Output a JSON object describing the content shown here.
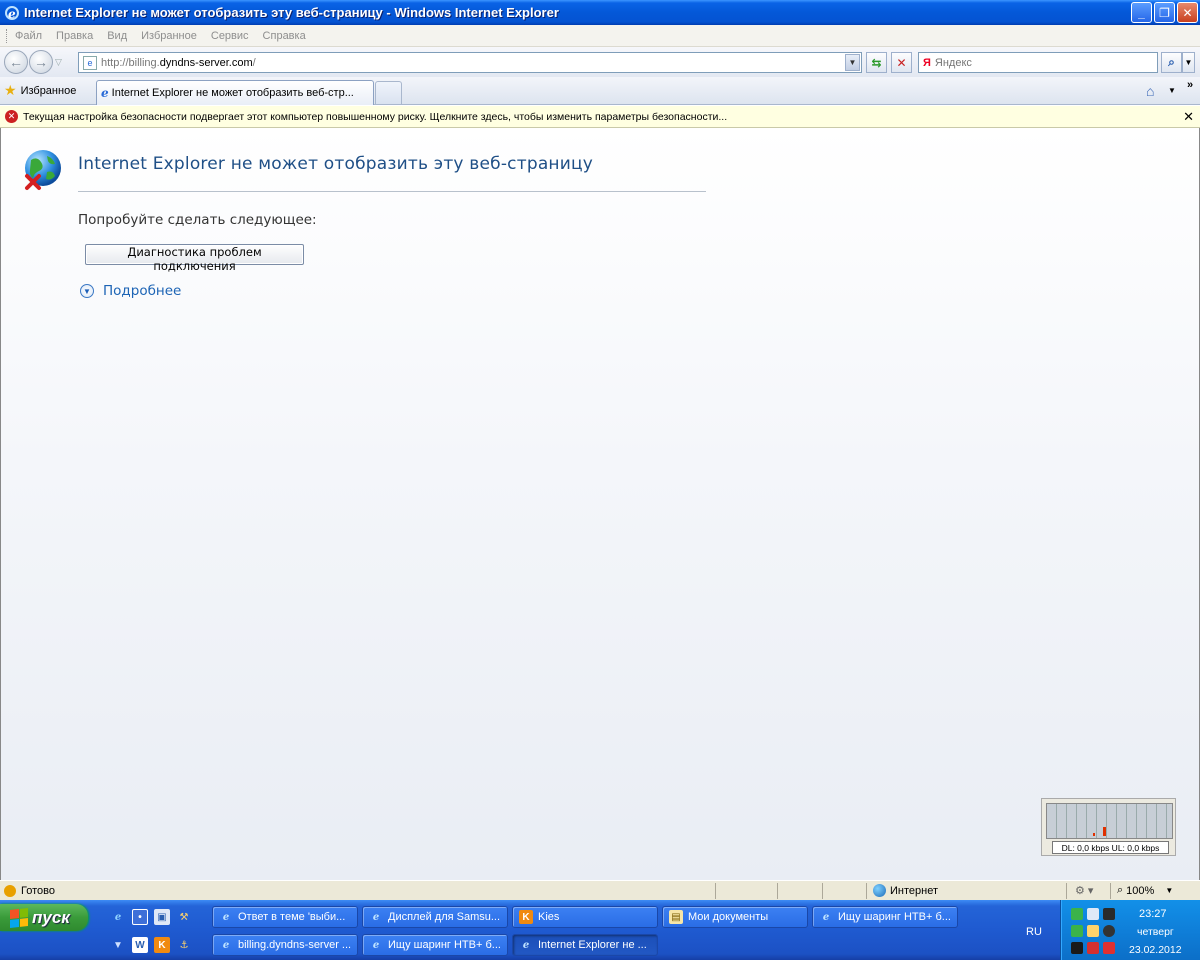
{
  "window": {
    "title": "Internet Explorer не может отобразить эту веб-страницу - Windows Internet Explorer",
    "minimize_glyph": "_",
    "maximize_glyph": "❐",
    "close_glyph": "✕"
  },
  "menubar": {
    "items": [
      "Файл",
      "Правка",
      "Вид",
      "Избранное",
      "Сервис",
      "Справка"
    ]
  },
  "address": {
    "url_prefix": "http://billing.",
    "url_domain": "dyndns-server.com",
    "url_suffix": "/",
    "search_placeholder": "Яндекс",
    "search_logo": "Я"
  },
  "favorites": {
    "label": "Избранное",
    "tab_title": "Internet Explorer не может отобразить веб-стр..."
  },
  "infobar": {
    "message": "Текущая настройка безопасности подвергает этот компьютер повышенному риску. Щелкните здесь, чтобы изменить параметры безопасности...",
    "close_glyph": "✕"
  },
  "error_page": {
    "title": "Internet Explorer не может отобразить эту веб-страницу",
    "try_text": "Попробуйте сделать следующее:",
    "diagnose_button": "Диагностика проблем подключения",
    "more_info": "Подробнее"
  },
  "net_monitor": {
    "stats": "DL: 0,0 kbps  UL: 0,0 kbps"
  },
  "statusbar": {
    "status": "Готово",
    "zone": "Интернет",
    "zoom": "100%"
  },
  "taskbar": {
    "start_label": "пуск",
    "tasks_row1": [
      {
        "label": "Ответ в теме 'выби...",
        "icon": "ie-icon"
      },
      {
        "label": "Дисплей для Samsu...",
        "icon": "ie-icon"
      },
      {
        "label": "Kies",
        "icon": "kies-icon"
      },
      {
        "label": "Мои документы",
        "icon": "folder-icon"
      },
      {
        "label": "Ищу шаринг НТВ+ б...",
        "icon": "ie-icon"
      }
    ],
    "tasks_row2": [
      {
        "label": "billing.dyndns-server ...",
        "icon": "ie-icon"
      },
      {
        "label": "Ищу шаринг НТВ+ б...",
        "icon": "ie-icon"
      },
      {
        "label": "Internet Explorer не ...",
        "icon": "ie-icon"
      }
    ],
    "language": "RU",
    "clock_time": "23:27",
    "clock_day": "четверг",
    "clock_date": "23.02.2012"
  },
  "colors": {
    "titlebar": "#0458d8",
    "error_title": "#1f4f86",
    "link": "#1d64b5",
    "infobar_bg": "#ffffe1",
    "taskbar": "#1f5ad0",
    "start_button": "#3a9b3a"
  }
}
